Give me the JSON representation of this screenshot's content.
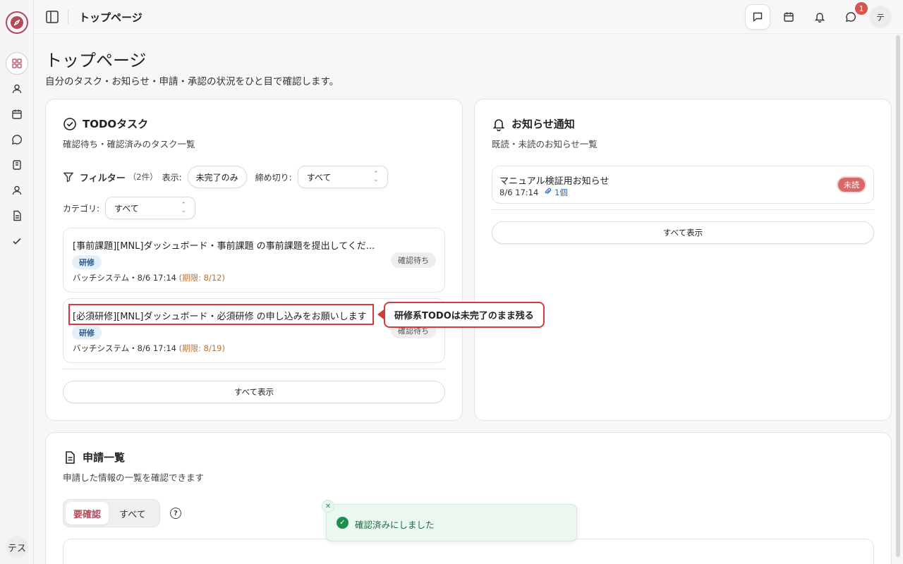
{
  "topbar": {
    "title": "トップページ"
  },
  "sidebar": {
    "items": [
      {
        "icon": "grid-icon"
      },
      {
        "icon": "user-icon"
      },
      {
        "icon": "calendar-icon"
      },
      {
        "icon": "chat-icon"
      },
      {
        "icon": "book-icon"
      },
      {
        "icon": "user-icon"
      },
      {
        "icon": "document-icon"
      },
      {
        "icon": "check-icon"
      }
    ],
    "avatar": "テス"
  },
  "header_actions": {
    "notification_count": "1",
    "avatar": "テ"
  },
  "page": {
    "title": "トップページ",
    "description": "自分のタスク・お知らせ・申請・承認の状況をひと目で確認します。"
  },
  "todo": {
    "title": "TODOタスク",
    "subtitle": "確認待ち・確認済みのタスク一覧",
    "filter_label": "フィルター",
    "filter_count": "（2件）",
    "display_label": "表示:",
    "display_value": "未完了のみ",
    "deadline_label": "締め切り:",
    "deadline_value": "すべて",
    "category_label": "カテゴリ:",
    "category_value": "すべて",
    "tasks": [
      {
        "title": "[事前課題][MNL]ダッシュボード・事前課題 の事前課題を提出してくだ...",
        "tag": "研修",
        "status": "確認待ち",
        "meta": "バッチシステム・8/6 17:14",
        "due": "(期限: 8/12)"
      },
      {
        "title": "[必須研修][MNL]ダッシュボード・必須研修 の申し込みをお願いします",
        "tag": "研修",
        "status": "確認待ち",
        "meta": "バッチシステム・8/6 17:14",
        "due": "(期限: 8/19)"
      }
    ],
    "show_all": "すべて表示"
  },
  "callout": {
    "text": "研修系TODOは未完了のまま残る"
  },
  "notices": {
    "title": "お知らせ通知",
    "subtitle": "既読・未読のお知らせ一覧",
    "items": [
      {
        "title": "マニュアル検証用お知らせ",
        "date": "8/6 17:14",
        "attachments": "1個",
        "status": "未読"
      }
    ],
    "show_all": "すべて表示"
  },
  "applications": {
    "title": "申請一覧",
    "subtitle": "申請した情報の一覧を確認できます",
    "tabs": [
      {
        "label": "要確認",
        "active": true
      },
      {
        "label": "すべて",
        "active": false
      }
    ],
    "help": "?"
  },
  "toast": {
    "message": "確認済みにしました"
  },
  "colors": {
    "brand": "#b5485d",
    "highlight": "#d33a3a",
    "success": "#1e8e4e",
    "due": "#c0712a"
  }
}
